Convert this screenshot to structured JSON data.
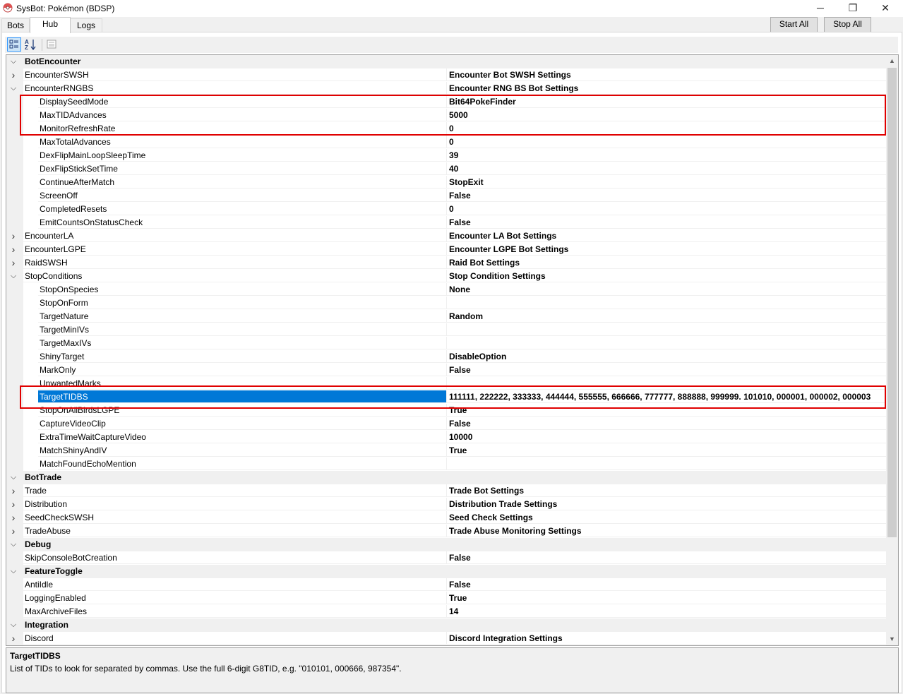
{
  "window": {
    "title": "SysBot: Pokémon (BDSP)",
    "minimize": "─",
    "maximize": "❐",
    "close": "✕"
  },
  "tabs": [
    {
      "label": "Bots"
    },
    {
      "label": "Hub"
    },
    {
      "label": "Logs"
    }
  ],
  "buttons": {
    "start_all": "Start All",
    "stop_all": "Stop All"
  },
  "toolbar": {
    "categorized_icon": "categorized-icon",
    "alphabetical_icon": "alphabetical-icon",
    "property_pages_icon": "property-pages-icon"
  },
  "grid": {
    "rows": [
      {
        "kind": "cat",
        "name": "BotEncounter",
        "expanded": true
      },
      {
        "kind": "prop",
        "level": 1,
        "name": "EncounterSWSH",
        "value": "Encounter Bot SWSH Settings",
        "expander": "collapsed"
      },
      {
        "kind": "prop",
        "level": 1,
        "name": "EncounterRNGBS",
        "value": "Encounter RNG BS Bot Settings",
        "expander": "expanded"
      },
      {
        "kind": "prop",
        "level": 2,
        "name": "DisplaySeedMode",
        "value": "Bit64PokeFinder"
      },
      {
        "kind": "prop",
        "level": 2,
        "name": "MaxTIDAdvances",
        "value": "5000"
      },
      {
        "kind": "prop",
        "level": 2,
        "name": "MonitorRefreshRate",
        "value": "0"
      },
      {
        "kind": "prop",
        "level": 2,
        "name": "MaxTotalAdvances",
        "value": "0"
      },
      {
        "kind": "prop",
        "level": 2,
        "name": "DexFlipMainLoopSleepTime",
        "value": "39"
      },
      {
        "kind": "prop",
        "level": 2,
        "name": "DexFlipStickSetTime",
        "value": "40"
      },
      {
        "kind": "prop",
        "level": 2,
        "name": "ContinueAfterMatch",
        "value": "StopExit"
      },
      {
        "kind": "prop",
        "level": 2,
        "name": "ScreenOff",
        "value": "False"
      },
      {
        "kind": "prop",
        "level": 2,
        "name": "CompletedResets",
        "value": "0"
      },
      {
        "kind": "prop",
        "level": 2,
        "name": "EmitCountsOnStatusCheck",
        "value": "False"
      },
      {
        "kind": "prop",
        "level": 1,
        "name": "EncounterLA",
        "value": "Encounter LA Bot Settings",
        "expander": "collapsed"
      },
      {
        "kind": "prop",
        "level": 1,
        "name": "EncounterLGPE",
        "value": "Encounter LGPE Bot Settings",
        "expander": "collapsed"
      },
      {
        "kind": "prop",
        "level": 1,
        "name": "RaidSWSH",
        "value": "Raid Bot Settings",
        "expander": "collapsed"
      },
      {
        "kind": "prop",
        "level": 1,
        "name": "StopConditions",
        "value": "Stop Condition Settings",
        "expander": "expanded"
      },
      {
        "kind": "prop",
        "level": 2,
        "name": "StopOnSpecies",
        "value": "None"
      },
      {
        "kind": "prop",
        "level": 2,
        "name": "StopOnForm",
        "value": ""
      },
      {
        "kind": "prop",
        "level": 2,
        "name": "TargetNature",
        "value": "Random"
      },
      {
        "kind": "prop",
        "level": 2,
        "name": "TargetMinIVs",
        "value": ""
      },
      {
        "kind": "prop",
        "level": 2,
        "name": "TargetMaxIVs",
        "value": ""
      },
      {
        "kind": "prop",
        "level": 2,
        "name": "ShinyTarget",
        "value": "DisableOption"
      },
      {
        "kind": "prop",
        "level": 2,
        "name": "MarkOnly",
        "value": "False"
      },
      {
        "kind": "prop",
        "level": 2,
        "name": "UnwantedMarks",
        "value": ""
      },
      {
        "kind": "prop",
        "level": 2,
        "name": "TargetTIDBS",
        "value": "111111, 222222, 333333, 444444, 555555, 666666, 777777, 888888, 999999. 101010, 000001, 000002, 000003",
        "selected": true
      },
      {
        "kind": "prop",
        "level": 2,
        "name": "StopOnAllBirdsLGPE",
        "value": "True"
      },
      {
        "kind": "prop",
        "level": 2,
        "name": "CaptureVideoClip",
        "value": "False"
      },
      {
        "kind": "prop",
        "level": 2,
        "name": "ExtraTimeWaitCaptureVideo",
        "value": "10000"
      },
      {
        "kind": "prop",
        "level": 2,
        "name": "MatchShinyAndIV",
        "value": "True"
      },
      {
        "kind": "prop",
        "level": 2,
        "name": "MatchFoundEchoMention",
        "value": ""
      },
      {
        "kind": "cat",
        "name": "BotTrade",
        "expanded": true
      },
      {
        "kind": "prop",
        "level": 1,
        "name": "Trade",
        "value": "Trade Bot Settings",
        "expander": "collapsed"
      },
      {
        "kind": "prop",
        "level": 1,
        "name": "Distribution",
        "value": "Distribution Trade Settings",
        "expander": "collapsed"
      },
      {
        "kind": "prop",
        "level": 1,
        "name": "SeedCheckSWSH",
        "value": "Seed Check Settings",
        "expander": "collapsed"
      },
      {
        "kind": "prop",
        "level": 1,
        "name": "TradeAbuse",
        "value": "Trade Abuse Monitoring Settings",
        "expander": "collapsed"
      },
      {
        "kind": "cat",
        "name": "Debug",
        "expanded": true
      },
      {
        "kind": "prop",
        "level": 1,
        "name": "SkipConsoleBotCreation",
        "value": "False"
      },
      {
        "kind": "cat",
        "name": "FeatureToggle",
        "expanded": true
      },
      {
        "kind": "prop",
        "level": 1,
        "name": "AntiIdle",
        "value": "False"
      },
      {
        "kind": "prop",
        "level": 1,
        "name": "LoggingEnabled",
        "value": "True"
      },
      {
        "kind": "prop",
        "level": 1,
        "name": "MaxArchiveFiles",
        "value": "14"
      },
      {
        "kind": "cat",
        "name": "Integration",
        "expanded": true
      },
      {
        "kind": "prop",
        "level": 1,
        "name": "Discord",
        "value": "Discord Integration Settings",
        "expander": "collapsed"
      }
    ]
  },
  "help": {
    "title": "TargetTIDBS",
    "description": "List of TIDs to look for separated by commas. Use the full 6-digit G8TID, e.g. \"010101, 000666, 987354\"."
  },
  "colors": {
    "selection": "#0078d7",
    "highlight_box": "#e00000"
  }
}
